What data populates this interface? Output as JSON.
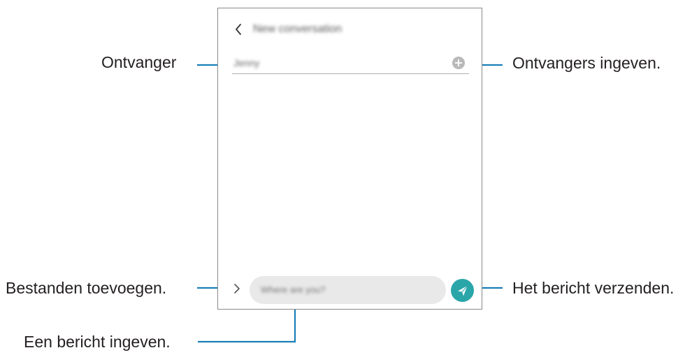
{
  "screen": {
    "title": "New conversation",
    "recipient_value": "Jenny",
    "message_placeholder": "Where are you?"
  },
  "callouts": {
    "recipient": "Ontvanger",
    "add_recipients": "Ontvangers ingeven.",
    "attach_files": "Bestanden toevoegen.",
    "send_message": "Het bericht verzenden.",
    "enter_message": "Een bericht ingeven."
  },
  "icons": {
    "back": "chevron-left-icon",
    "add": "plus-circle-icon",
    "attach": "chevron-right-icon",
    "send": "send-icon"
  },
  "colors": {
    "callout_line": "#1a7fb8",
    "send_button": "#2aa6a9",
    "input_background": "#e9e9e9",
    "add_button": "#b9b9b9"
  }
}
